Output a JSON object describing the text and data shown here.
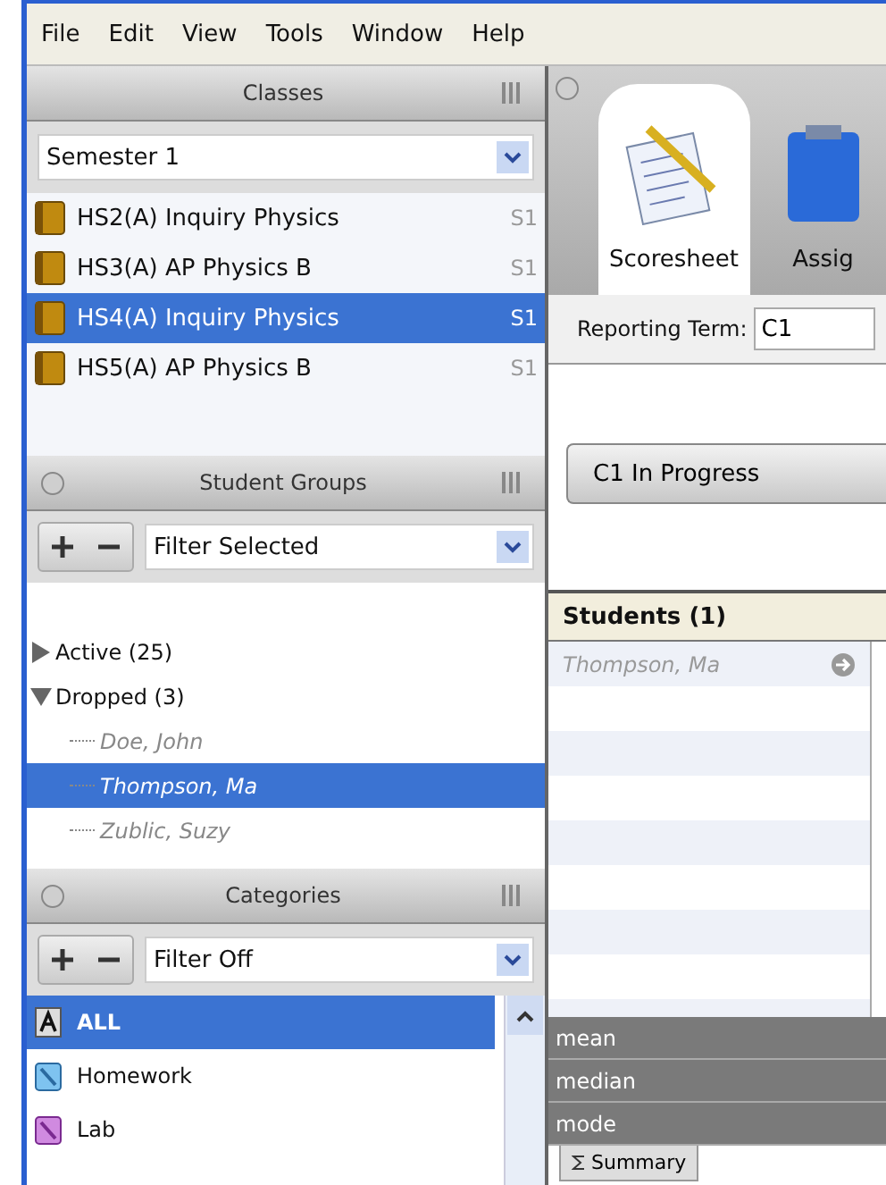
{
  "menu": [
    "File",
    "Edit",
    "View",
    "Tools",
    "Window",
    "Help"
  ],
  "classes_panel": {
    "title": "Classes",
    "collapsible": false,
    "term_select": {
      "value": "Semester 1"
    },
    "items": [
      {
        "label": "HS2(A) Inquiry Physics",
        "term": "S1",
        "selected": false
      },
      {
        "label": "HS3(A) AP Physics B",
        "term": "S1",
        "selected": false
      },
      {
        "label": "HS4(A) Inquiry Physics",
        "term": "S1",
        "selected": true
      },
      {
        "label": "HS5(A) AP Physics B",
        "term": "S1",
        "selected": false
      }
    ]
  },
  "student_groups_panel": {
    "title": "Student Groups",
    "collapsible": true,
    "filter": {
      "value": "Filter Selected"
    },
    "tree": [
      {
        "label": "Active (25)",
        "expanded": false
      },
      {
        "label": "Dropped (3)",
        "expanded": true,
        "children": [
          {
            "label": "Doe, John",
            "selected": false
          },
          {
            "label": "Thompson, Ma",
            "selected": true
          },
          {
            "label": "Zublic, Suzy",
            "selected": false
          }
        ]
      }
    ]
  },
  "categories_panel": {
    "title": "Categories",
    "collapsible": true,
    "filter": {
      "value": "Filter Off"
    },
    "items": [
      {
        "label": "ALL",
        "kind": "all",
        "selected": true
      },
      {
        "label": "Homework",
        "kind": "homework",
        "selected": false
      },
      {
        "label": "Lab",
        "kind": "lab",
        "selected": false
      }
    ]
  },
  "toolbar_tabs": [
    {
      "label": "Scoresheet",
      "kind": "scoresheet",
      "selected": true
    },
    {
      "label": "Assig",
      "kind": "clipboard",
      "selected": false
    }
  ],
  "reporting_term": {
    "label": "Reporting Term:",
    "value": "C1"
  },
  "status_button": "C1 In Progress",
  "students_table": {
    "header": "Students (1)",
    "rows": [
      {
        "name": "Thompson, Ma"
      }
    ]
  },
  "stats": [
    "mean",
    "median",
    "mode"
  ],
  "bottom_tabs": [
    {
      "label": "Summary",
      "selected": true
    }
  ]
}
